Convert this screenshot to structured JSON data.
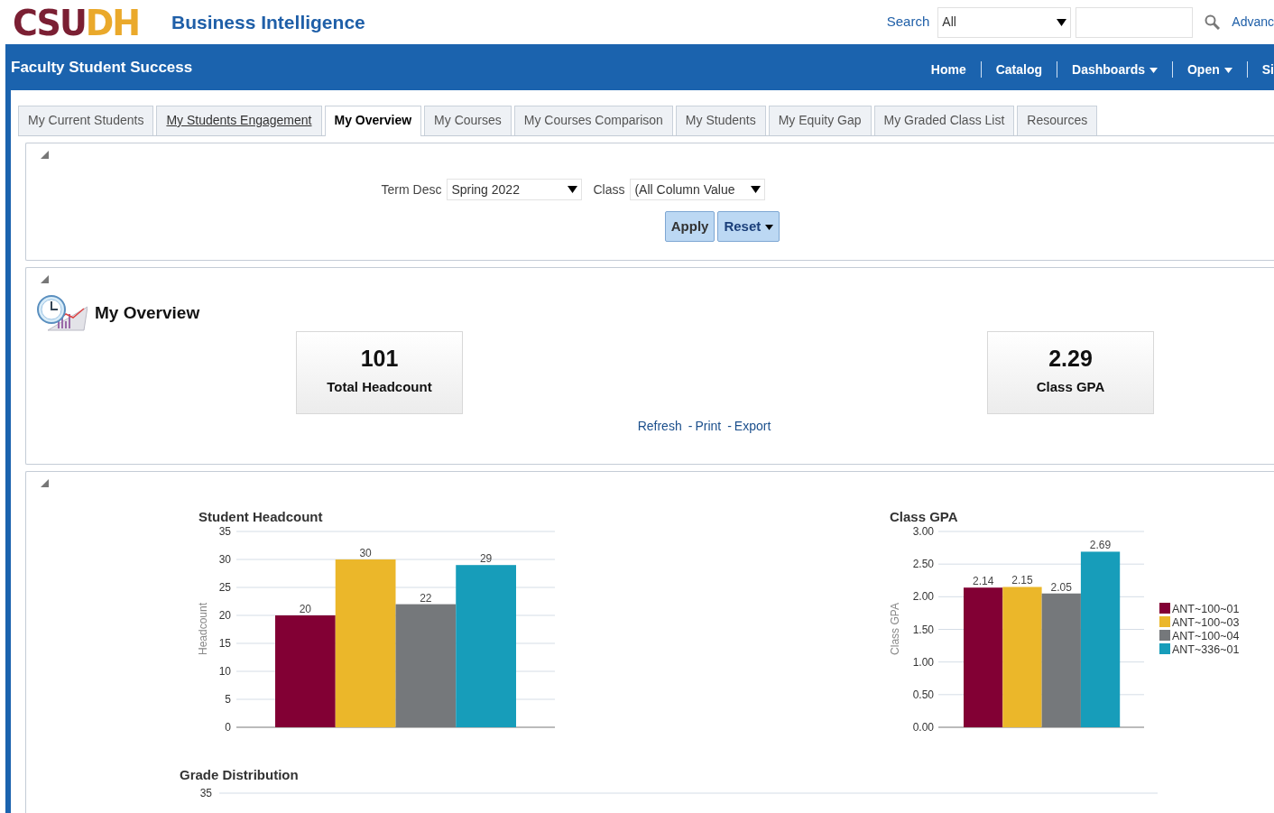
{
  "header": {
    "logo": {
      "primary": "CSU",
      "accent": "DH"
    },
    "app_title": "Business Intelligence",
    "search_label": "Search",
    "search_scope": "All",
    "advanced_link": "Advanc"
  },
  "navbar": {
    "title": "Faculty Student Success",
    "items": [
      {
        "label": "Home",
        "has_menu": false
      },
      {
        "label": "Catalog",
        "has_menu": false
      },
      {
        "label": "Dashboards",
        "has_menu": true
      },
      {
        "label": "Open",
        "has_menu": true
      },
      {
        "label": "Si",
        "has_menu": false
      }
    ]
  },
  "tabs": [
    {
      "label": "My Current Students",
      "selected": false,
      "hovered": false
    },
    {
      "label": "My Students Engagement",
      "selected": false,
      "hovered": true
    },
    {
      "label": "My Overview",
      "selected": true,
      "hovered": false
    },
    {
      "label": "My Courses",
      "selected": false,
      "hovered": false
    },
    {
      "label": "My Courses Comparison",
      "selected": false,
      "hovered": false
    },
    {
      "label": "My Students",
      "selected": false,
      "hovered": false
    },
    {
      "label": "My Equity Gap",
      "selected": false,
      "hovered": false
    },
    {
      "label": "My Graded Class List",
      "selected": false,
      "hovered": false
    },
    {
      "label": "Resources",
      "selected": false,
      "hovered": false
    }
  ],
  "prompts": {
    "fields": [
      {
        "label": "Term Desc",
        "value": "Spring 2022"
      },
      {
        "label": "Class",
        "value": "(All Column Value"
      }
    ],
    "buttons": [
      {
        "label": "Apply",
        "has_menu": false
      },
      {
        "label": "Reset",
        "has_menu": true
      }
    ]
  },
  "overview": {
    "title": "My Overview",
    "tiles": [
      {
        "value": "101",
        "label": "Total Headcount"
      },
      {
        "value": "2.29",
        "label": "Class GPA"
      }
    ],
    "links": [
      {
        "label": "Refresh"
      },
      {
        "label": "Print",
        "separator": "-"
      },
      {
        "label": "Export",
        "separator": "-"
      }
    ]
  },
  "charts": [
    {
      "chart_data": {
        "type": "bar",
        "title": "Student Headcount",
        "ylabel": "Headcount",
        "grid": true,
        "ylim": [
          0,
          35
        ],
        "yticks": [
          0,
          5,
          10,
          15,
          20,
          25,
          30,
          35
        ],
        "data_labels": true,
        "series": [
          {
            "color": "#820034",
            "values": [
              20
            ]
          },
          {
            "color": "#ebb72a",
            "values": [
              30
            ]
          },
          {
            "color": "#75787b",
            "values": [
              22
            ]
          },
          {
            "color": "#179dba",
            "values": [
              29
            ]
          }
        ]
      }
    },
    {
      "chart_data": {
        "type": "bar",
        "title": "Class GPA",
        "ylabel": "Class GPA",
        "grid": true,
        "legend": true,
        "ylim": [
          0,
          3
        ],
        "yticks": [
          {
            "value": 0,
            "label": "0.00"
          },
          {
            "value": 0.5,
            "label": "0.50"
          },
          {
            "value": 1,
            "label": "1.00"
          },
          {
            "value": 1.5,
            "label": "1.50"
          },
          {
            "value": 2,
            "label": "2.00"
          },
          {
            "value": 2.5,
            "label": "2.50"
          },
          {
            "value": 3,
            "label": "3.00"
          }
        ],
        "data_labels": true,
        "series": [
          {
            "name": "ANT~100~01",
            "color": "#820034",
            "values": [
              2.14
            ]
          },
          {
            "name": "ANT~100~03",
            "color": "#ebb72a",
            "values": [
              2.15
            ]
          },
          {
            "name": "ANT~100~04",
            "color": "#75787b",
            "values": [
              2.05
            ]
          },
          {
            "name": "ANT~336~01",
            "color": "#179dba",
            "values": [
              2.69
            ]
          }
        ]
      }
    }
  ],
  "grade_distribution": {
    "title": "Grade Distribution",
    "tick_label": "35"
  }
}
